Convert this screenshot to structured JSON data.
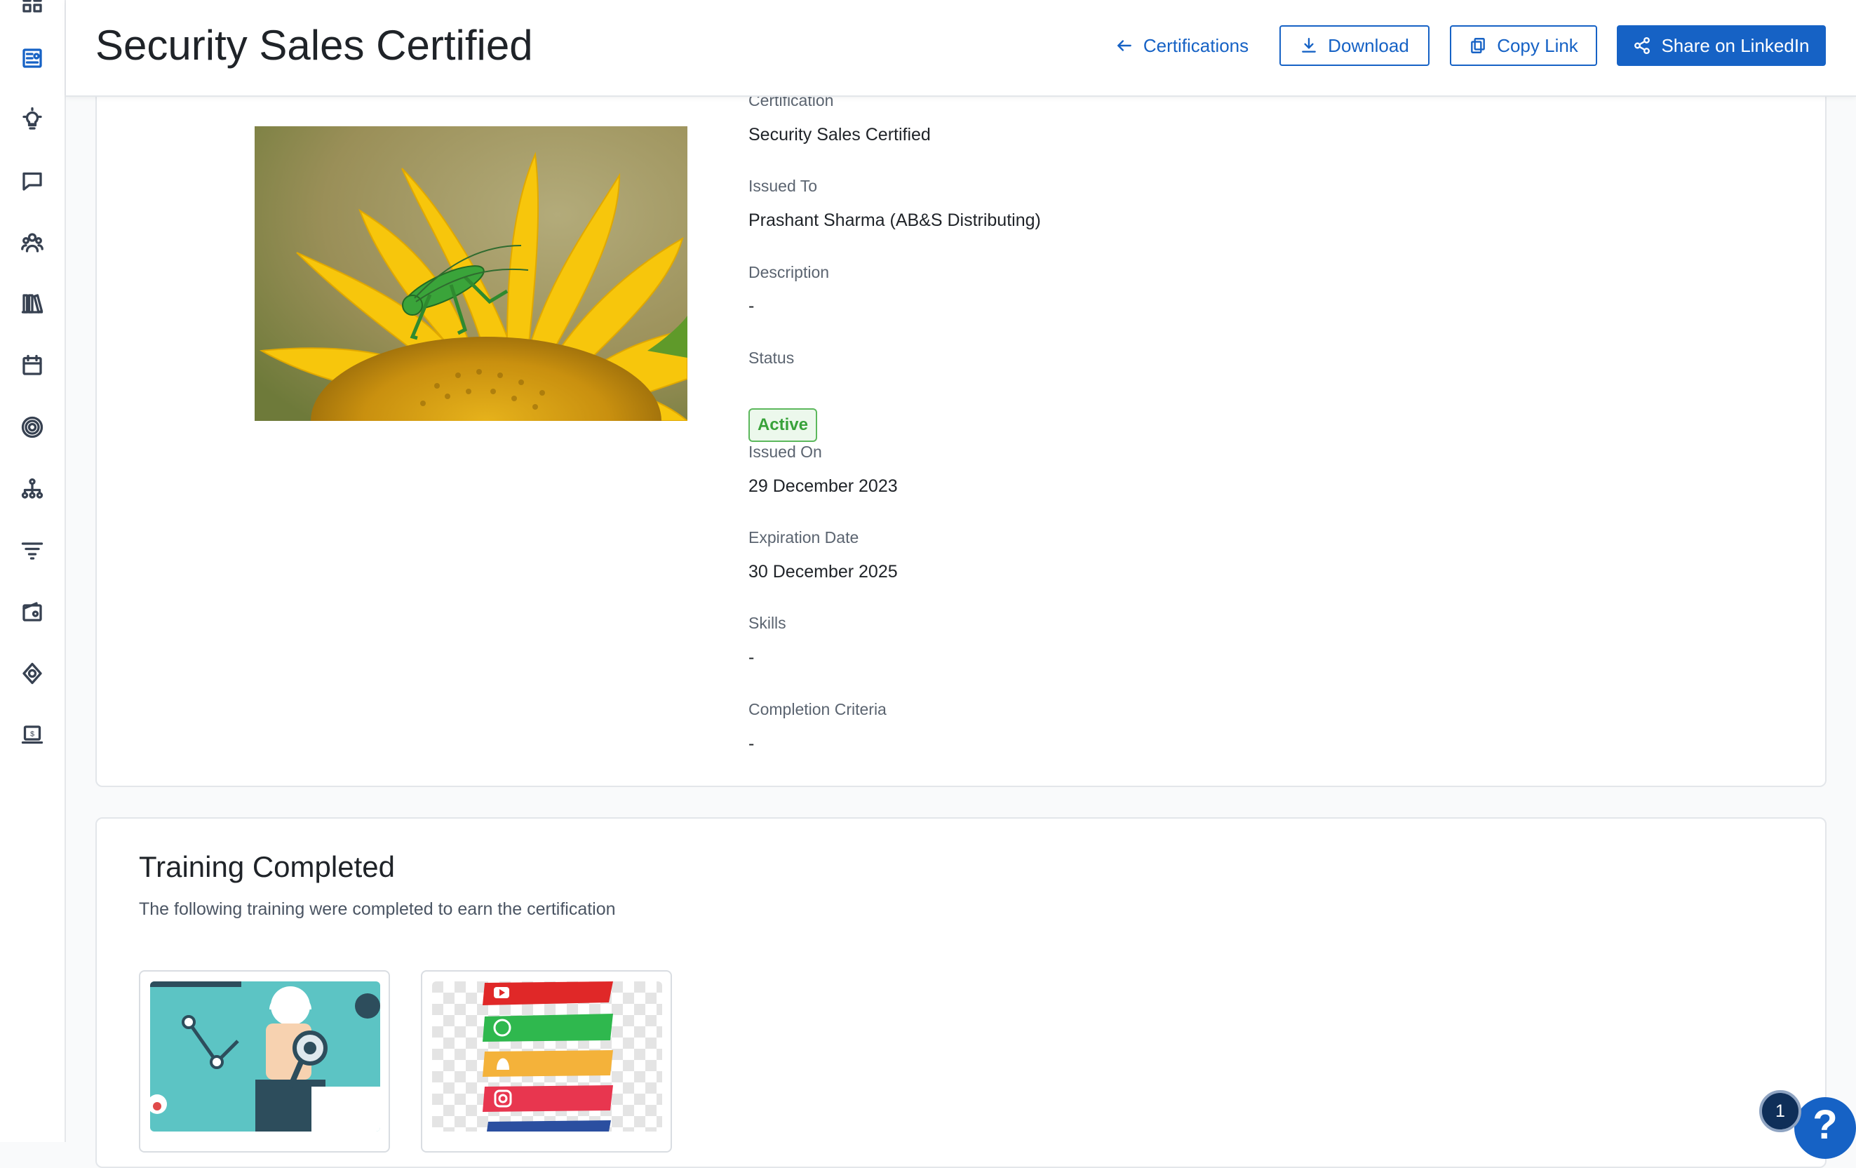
{
  "header": {
    "title": "Security Sales Certified",
    "back_link": "Certifications",
    "download_label": "Download",
    "copy_link_label": "Copy Link",
    "share_label": "Share on LinkedIn"
  },
  "sidebar": {
    "items": [
      {
        "icon": "grid-icon"
      },
      {
        "icon": "certificate-icon",
        "active": true
      },
      {
        "icon": "lightbulb-icon"
      },
      {
        "icon": "chat-icon"
      },
      {
        "icon": "team-icon"
      },
      {
        "icon": "library-icon"
      },
      {
        "icon": "calendar-icon"
      },
      {
        "icon": "target-icon"
      },
      {
        "icon": "hierarchy-icon"
      },
      {
        "icon": "filter-icon"
      },
      {
        "icon": "wallet-icon"
      },
      {
        "icon": "integration-icon"
      },
      {
        "icon": "billing-icon"
      }
    ]
  },
  "details": {
    "certification_label": "Certification",
    "certification_value": "Security Sales Certified",
    "issued_to_label": "Issued To",
    "issued_to_value": "Prashant Sharma (AB&S Distributing)",
    "description_label": "Description",
    "description_value": "-",
    "status_label": "Status",
    "status_value": "Active",
    "issued_on_label": "Issued On",
    "issued_on_value": "29 December 2023",
    "expiration_label": "Expiration Date",
    "expiration_value": "30 December 2025",
    "skills_label": "Skills",
    "skills_value": "-",
    "completion_label": "Completion Criteria",
    "completion_value": "-"
  },
  "training": {
    "title": "Training Completed",
    "subtitle": "The following training were completed to earn the certification"
  },
  "help": {
    "count": "1",
    "icon_label": "?"
  },
  "colors": {
    "accent": "#1662c5",
    "status_active": "#38a23a"
  }
}
